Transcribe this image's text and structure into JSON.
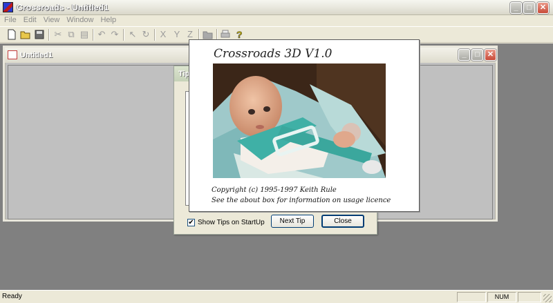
{
  "window": {
    "title": "Crossroads - Untitled1"
  },
  "menu": [
    "File",
    "Edit",
    "View",
    "Window",
    "Help"
  ],
  "toolbar": {
    "icons": [
      "new-icon",
      "open-icon",
      "save-icon",
      "cut-icon",
      "copy-icon",
      "paste-icon",
      "undo-icon",
      "redo-icon",
      "select-arrow-icon",
      "rotate-icon",
      "x-axis-icon",
      "y-axis-icon",
      "z-axis-icon",
      "folder-icon",
      "print-icon",
      "help-icon"
    ],
    "x_label": "X",
    "y_label": "Y",
    "z_label": "Z"
  },
  "child_window": {
    "title": "Untitled1"
  },
  "tips_dialog": {
    "title": "Tip",
    "show_tips_label": "Show Tips on StartUp",
    "show_tips_checked": true,
    "next_tip_label": "Next Tip",
    "close_label": "Close"
  },
  "splash": {
    "title": "Crossroads 3D V1.0",
    "copyright_line1": "Copyright (c) 1995-1997 Keith Rule",
    "copyright_line2": "See the about box for information on usage licence"
  },
  "status": {
    "text": "Ready",
    "num": "NUM"
  }
}
